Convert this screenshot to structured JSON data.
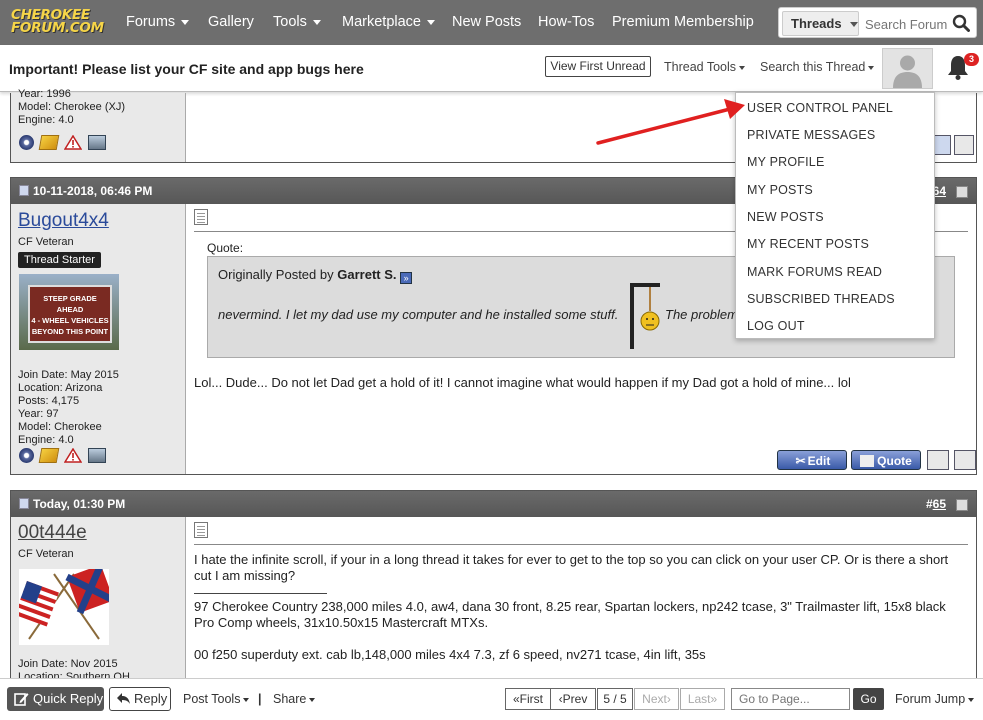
{
  "logo": {
    "line1": "CHEROKEE",
    "line2": "FORUM.COM"
  },
  "nav": {
    "forums": "Forums",
    "gallery": "Gallery",
    "tools": "Tools",
    "marketplace": "Marketplace",
    "new_posts": "New Posts",
    "howtos": "How-Tos",
    "premium": "Premium Membership"
  },
  "search": {
    "scope": "Threads",
    "placeholder": "Search Forum"
  },
  "subheader": {
    "important": "Important! Please list your CF site and app bugs here",
    "view_first_unread": "View First Unread",
    "thread_tools": "Thread Tools",
    "search_thread": "Search this Thread",
    "notification_count": "3"
  },
  "dropdown": {
    "items": [
      "USER CONTROL PANEL",
      "PRIVATE MESSAGES",
      "MY PROFILE",
      "MY POSTS",
      "NEW POSTS",
      "MY RECENT POSTS",
      "MARK FORUMS READ",
      "SUBSCRIBED THREADS",
      "LOG OUT"
    ]
  },
  "prev_post": {
    "year": "Year: 1996",
    "model": "Model: Cherokee (XJ)",
    "engine": "Engine: 4.0"
  },
  "post64": {
    "date": "10-11-2018, 06:46 PM",
    "number_prefix": "#",
    "number": "64",
    "username": "Bugout4x4",
    "title": "CF Veteran",
    "badge": "Thread Starter",
    "avatar_sign": [
      "STEEP GRADE AHEAD",
      "4 - WHEEL VEHICLES",
      "BEYOND THIS POINT"
    ],
    "join_date": "Join Date: May 2015",
    "location": "Location: Arizona",
    "posts": "Posts: 4,175",
    "year": "Year: 97",
    "model": "Model: Cherokee",
    "engine": "Engine: 4.0",
    "quote_label": "Quote:",
    "quote_by_prefix": "Originally Posted by",
    "quote_author": "Garrett S.",
    "quote_text": "nevermind. I let my dad use my computer and he installed some stuff.",
    "quote_text2": "The problem",
    "body": "Lol... Dude... Do not let Dad get a hold of it! I cannot imagine what would happen if my Dad got a hold of mine... lol",
    "edit_label": "Edit",
    "quote_button": "Quote"
  },
  "post65": {
    "date": "Today, 01:30 PM",
    "number_prefix": "#",
    "number": "65",
    "username": "00t444e",
    "title": "CF Veteran",
    "join_date": "Join Date: Nov 2015",
    "location": "Location: Southern OH",
    "body": "I hate the infinite scroll, if your in a long thread it takes for ever to get to the top so you can click on your user CP. Or is there a short cut I am missing?",
    "sig1": "97 Cherokee Country 238,000 miles 4.0, aw4, dana 30 front, 8.25 rear, Spartan lockers, np242 tcase, 3\" Trailmaster lift, 15x8 black Pro Comp wheels, 31x10.50x15 Mastercraft MTXs.",
    "sig2": "00 f250 superduty ext. cab lb,148,000 miles 4x4 7.3, zf 6 speed, nv271 tcase, 4in lift, 35s"
  },
  "footer": {
    "quick_reply": "Quick Reply",
    "reply": "Reply",
    "post_tools": "Post Tools",
    "share": "Share",
    "separator": "|",
    "first": "First",
    "prev": "Prev",
    "page": "5 / 5",
    "next": "Next",
    "last": "Last",
    "goto_placeholder": "Go to Page...",
    "go": "Go",
    "forum_jump": "Forum Jump"
  },
  "colors": {
    "nav_bg": "#6e6e6e",
    "logo": "#f6d548",
    "link": "#2a4a9a",
    "annotation_arrow": "#e02020"
  }
}
